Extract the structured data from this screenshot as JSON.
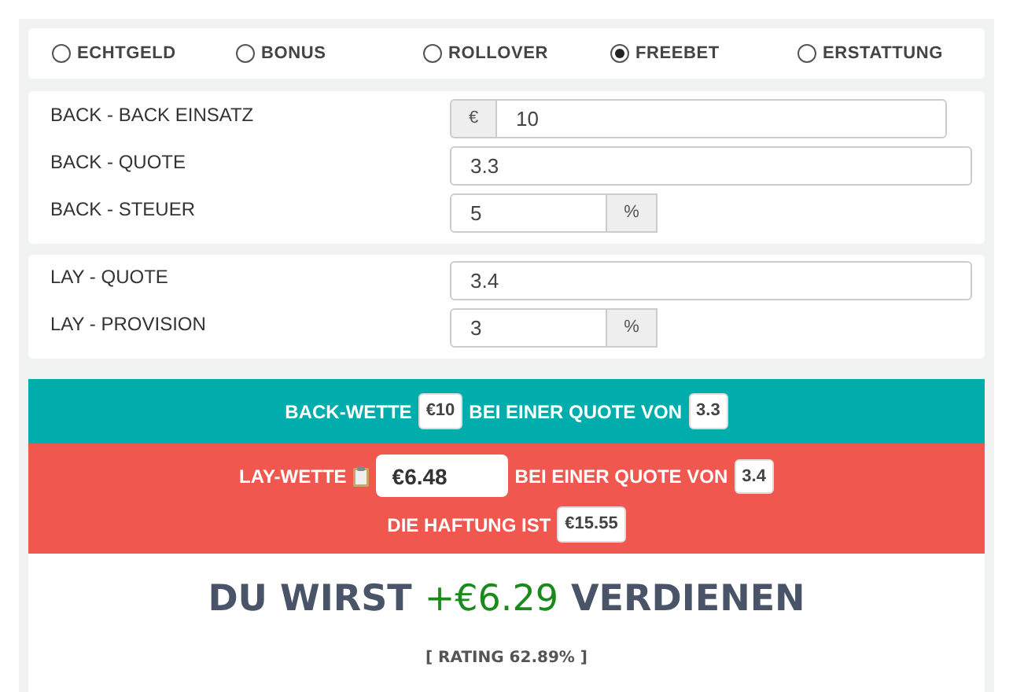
{
  "bet_types": [
    {
      "label": "ECHTGELD",
      "selected": false
    },
    {
      "label": "BONUS",
      "selected": false
    },
    {
      "label": "ROLLOVER",
      "selected": false
    },
    {
      "label": "FREEBET",
      "selected": true
    },
    {
      "label": "ERSTATTUNG",
      "selected": false
    }
  ],
  "back_fields": [
    {
      "label": "BACK - BACK EINSATZ",
      "value": "10",
      "kind": "prefix",
      "addon": "€"
    },
    {
      "label": "BACK - QUOTE",
      "value": "3.3",
      "kind": "plain"
    },
    {
      "label": "BACK - STEUER",
      "value": "5",
      "kind": "suffix",
      "addon": "%"
    }
  ],
  "lay_fields": [
    {
      "label": "LAY - QUOTE",
      "value": "3.4",
      "kind": "plain"
    },
    {
      "label": "LAY - PROVISION",
      "value": "3",
      "kind": "suffix",
      "addon": "%"
    }
  ],
  "back_bet": {
    "label": "BACK-WETTE",
    "stake": "€10",
    "odds_label": "BEI EINER QUOTE VON",
    "odds": "3.3"
  },
  "lay_bet": {
    "label": "LAY-WETTE",
    "stake": "€6.48",
    "odds_label": "BEI EINER QUOTE VON",
    "odds": "3.4",
    "liability_label": "DIE HAFTUNG IST",
    "liability": "€15.55"
  },
  "result": {
    "prefix": "DU WIRST",
    "amount": "+€6.29",
    "suffix": "VERDIENEN",
    "rating": "[ RATING 62.89% ]"
  }
}
